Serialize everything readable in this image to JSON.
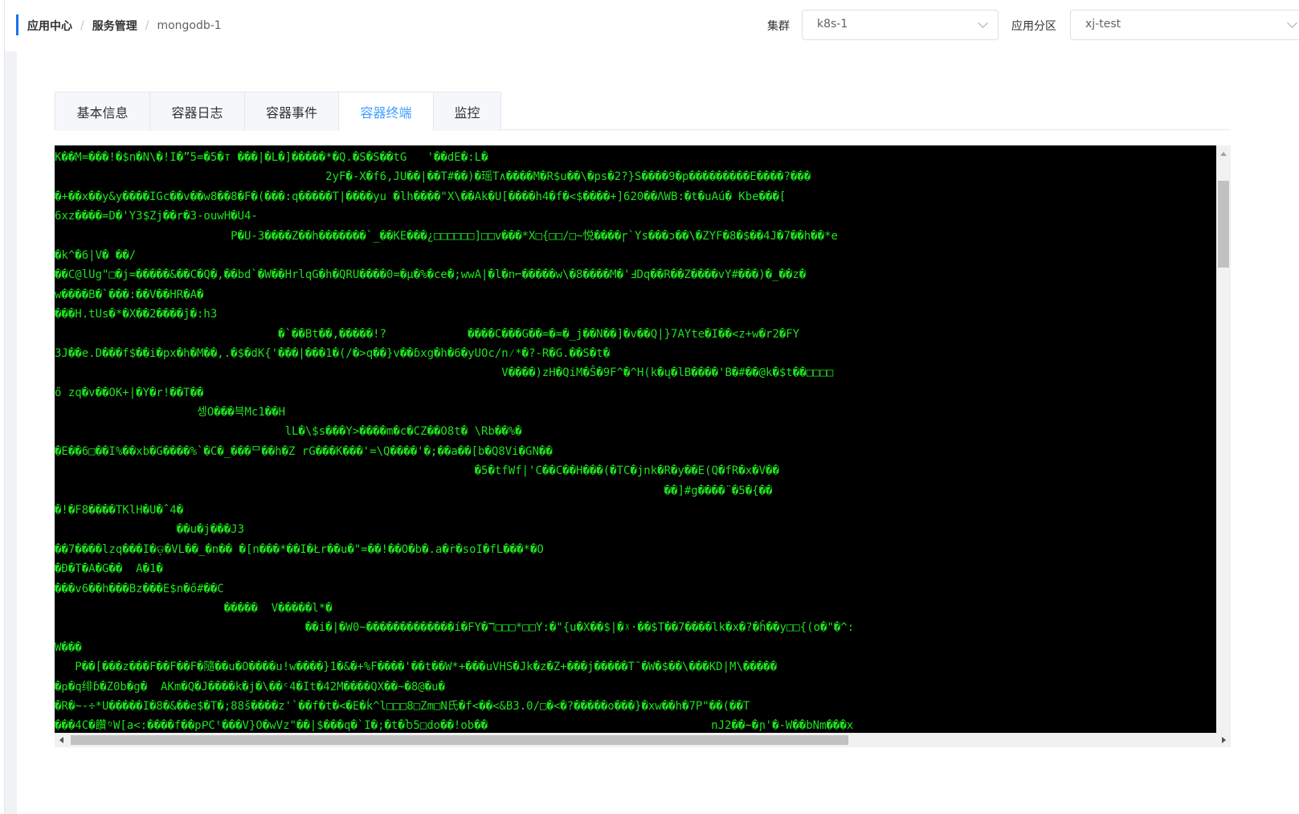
{
  "breadcrumb": {
    "items": [
      "应用中心",
      "服务管理",
      "mongodb-1"
    ],
    "separator": "/"
  },
  "filters": {
    "cluster_label": "集群",
    "cluster_value": "k8s-1",
    "partition_label": "应用分区",
    "partition_value": "xj-test"
  },
  "tabs": [
    {
      "label": "基本信息",
      "active": false
    },
    {
      "label": "容器日志",
      "active": false
    },
    {
      "label": "容器事件",
      "active": false
    },
    {
      "label": "容器终端",
      "active": true
    },
    {
      "label": "监控",
      "active": false
    }
  ],
  "colors": {
    "accent": "#409eff",
    "breadcrumb_marker": "#1a73e8",
    "terminal_bg": "#000000",
    "terminal_text": "#1ee21e"
  },
  "icons": {
    "select_arrow": "chevron-down-icon",
    "scroll_up": "arrow-up-icon",
    "scroll_left": "arrow-left-icon",
    "scroll_right": "arrow-right-icon"
  },
  "terminal": {
    "lines": [
      "K��M=���!�$n�N\\�!I�”5=�5�т ���|�L�]�����*�Q.�S�S��tG   '��dE�:L�",
      "                                        2yF�-X�f6,JU��|��T#��)�瑶T∧����M�R$u��\\�ps�2?}S����9�p���������E����?���",
      "�+��x��y&y����IGc��v��w8��8�F�(���:q�����T|����yu �lh����\"X\\��Ak�U[����h4�f�<$����+]620��ΛWB:�t�uAú� Kbe���[",
      "6xz����=D�'Y3$Zj��r�3-ouwH�U4-",
      "                          P�U-3����Z��h�������`_��KE���¿□□□□□□]□□v���*X□{□□/□~悦����ɼ`Ys���ɔ��\\�ZYF�8�$��4J�7��h��*e",
      "�k^�6|V� ��/",
      "��C@lUg\"□�j=�����&��C�Q�,��bd`�W��HrlqG�h�QRU����0=�μ�%�ce�;wwA|�l�n⌐�����w\\�8����M�'Ⅎ­Dq��R��Z����vY#���)�_��z�",
      "w����B�`���:��V��HR�A�",
      "���H.tUs�*�X��2����ĵ�:h3",
      "                                 �`��Bt��,�����!?            ����C���G��=�=�_j��N��]�v��Q|}7AYte�I��<z+w�r2�FY",
      "3J��e.D���f$��i�px�h�M��,.�$�dK{'���|���1�(/�>q��}v��ɓxg�h�6�yUOc/n⁄*�?-R�G.��S�t�",
      "                                                                  V����)zH�QiM�Ŝ�9F^�^H(k�ų�lB����'B�#��@k�$t��□□□□",
      "ő zq�v��OK+|�Y�r!��T��",
      "                     셍O���븍Mc1��H",
      "                                  lL�\\$s���Y>����m�c�CZ��O8t� \\Rb��%�",
      "�E��6□��I%��xb�G����%`�C�_���ᄆ��h�Z rG���K���'=\\Q����'�;��a��[b�Q8Vi�GN��",
      "                                                              �5�tfWf|'C��C��H���(�TC�jnk�R�y��E(Q�fR�x�V��",
      "                                                                                          ��]#g����¨�5�{��",
      "�!�F8����TKlH�U�ˆ4�",
      "                  ��u�j���J3",
      "��7����lzq���I�ଡ଼�VL��_�n�� �[n���*��I�Łr��u�\"=��!��O�b�.a�ṙ�soI�fL���*�O",
      "�Ð�T�A�G��  A�1�",
      "���v6��h���Bz���E$n�ő#��C",
      "                         �����  V�����l*�",
      "                                     ��i�|�W0~�������������í�FY�ℸ□□□*□□Y:�\"{u�X��$|�ᵡ·��$T��7����lk�x�?�ĥ��y□□{(o�\"�^:",
      "W���",
      "   P��[���z���F��F��F�隨��u�O����u!w����}1�&�+%F����'��t��W*+���uVHS�Jk�z�Z+���j�����T¯�W�$��\\���KD|M\\�����",
      "�ҏ�q绯ɓ�Z0b�g�  AKm�Q�J����k�j�\\��ᶜ4�It�42M����QX��~�8@�u�",
      "�R�~-÷*U�����I�8�&��e$�T�;88š����z'`��f�t�<�E�ḱ^l□□□8□Zm□N氏�f<��<&B3.0/□�<�?�����o���}�xw��h�7P\"��(��T",
      "���4C�饡ᵑW[a<:����f��pᑭCᵗ���V}O�wVz\"��|$���q�`I�;�t�Ⴆ5□do��!ob��                                 nJ2��~�ɲ'�-W��bNm���x"
    ]
  }
}
